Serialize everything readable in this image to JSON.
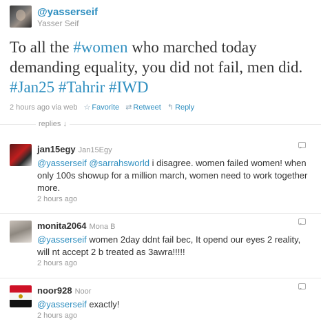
{
  "author": {
    "screen_name": "@yasserseif",
    "full_name": "Yasser Seif"
  },
  "tweet": {
    "segments": [
      {
        "text": "To all the ",
        "hashtag": false
      },
      {
        "text": "#women",
        "hashtag": true
      },
      {
        "text": " who marched today demanding equality, you did not fail, men did. ",
        "hashtag": false
      },
      {
        "text": "#Jan25",
        "hashtag": true
      },
      {
        "text": " ",
        "hashtag": false
      },
      {
        "text": "#Tahrir",
        "hashtag": true
      },
      {
        "text": " ",
        "hashtag": false
      },
      {
        "text": "#IWD",
        "hashtag": true
      }
    ],
    "meta": "2 hours ago via web",
    "actions": {
      "favorite": "Favorite",
      "retweet": "Retweet",
      "reply": "Reply"
    }
  },
  "replies_label": "replies ↓",
  "replies": [
    {
      "screen_name": "jan15egy",
      "real_name": "Jan15Egy",
      "mentions": [
        "@yasserseif",
        "@sarrahsworld"
      ],
      "text": " i disagree. women failed women! when only 100s showup for a million march, women need to work together more.",
      "time": "2 hours ago"
    },
    {
      "screen_name": "monita2064",
      "real_name": "Mona B",
      "mentions": [
        "@yasserseif"
      ],
      "text": " women 2day ddnt fail bec, It opend our eyes 2 reality, will nt accept 2 b treated as 3awra!!!!!",
      "time": "2 hours ago"
    },
    {
      "screen_name": "noor928",
      "real_name": "Noor",
      "mentions": [
        "@yasserseif"
      ],
      "text": " exactly!",
      "time": "2 hours ago"
    }
  ],
  "colors": {
    "link": "#2f8fc0",
    "text": "#333333",
    "muted": "#999999"
  }
}
